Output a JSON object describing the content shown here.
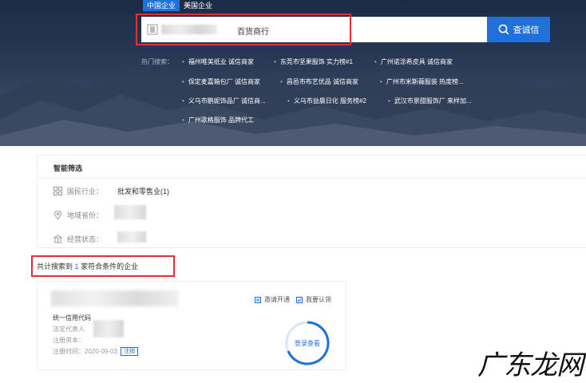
{
  "tabs": [
    {
      "label": "中国企业",
      "active": true
    },
    {
      "label": "美国企业",
      "active": false
    }
  ],
  "search": {
    "value": "百货商行",
    "button_label": "查诚信"
  },
  "hot_search": {
    "label": "热门搜索：",
    "items": [
      "福州唯美纸业 诚信商家",
      "东莞市坚果服饰 实力榜#1",
      "广州诺涂希皮具 诚信商家",
      "保定麦嘉箱包厂 诚信商家",
      "昌邑市布艺优品 诚信商家",
      "广州市米斯薇服装 热度榜...",
      "义乌市鹏妮饰品厂 诚信商...",
      "义乌市益晨日化 服务榜#2",
      "武汉市景甜服饰厂 来样加...",
      "广州歌格服饰 品牌代工"
    ]
  },
  "filter": {
    "title": "智能筛选",
    "industry_label": "国民行业：",
    "industry_value": "批发和零售业(1)",
    "region_label": "地域省份：",
    "status_label": "经营状态："
  },
  "results": {
    "prefix": "共计搜索到",
    "count": "1",
    "suffix": "家符合条件的企业"
  },
  "company": {
    "credit_code_label": "统一信用代码",
    "legal_rep_label": "法定代表人",
    "capital_label": "注册资本：",
    "reg_time_label": "注册时间：2020-09-03",
    "status_tag": "注销",
    "invite_label": "邀请开通",
    "claim_label": "我要认领",
    "login_view_label": "登录查看"
  },
  "watermark": "广东龙网",
  "colors": {
    "primary": "#1f70d8",
    "highlight_red": "#e0313b"
  }
}
